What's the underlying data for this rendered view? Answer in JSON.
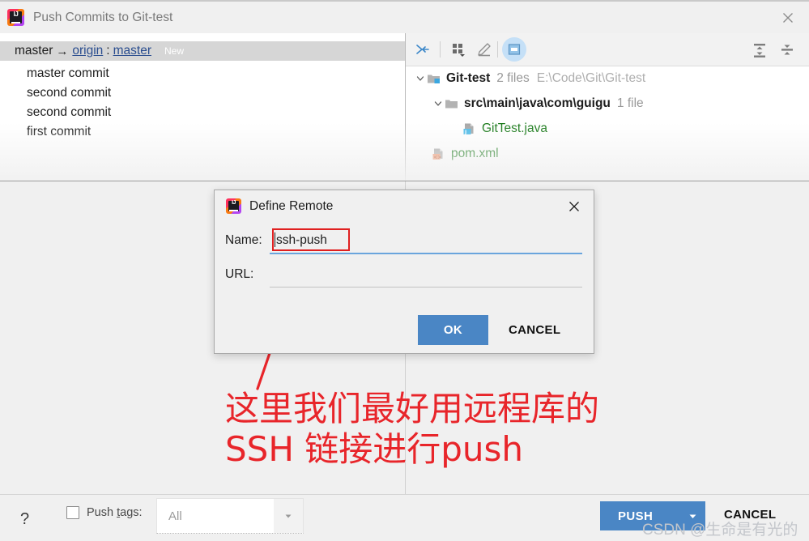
{
  "window": {
    "title": "Push Commits to Git-test",
    "app_icon": "intellij-idea-icon",
    "close_label": "close-icon"
  },
  "left_pane": {
    "branch_row": {
      "local_branch": "master",
      "arrow": "→",
      "remote": "origin",
      "separator": ":",
      "remote_branch": "master",
      "badge": "New"
    },
    "commits": [
      {
        "message": "master commit"
      },
      {
        "message": "second commit"
      },
      {
        "message": "second commit"
      },
      {
        "message": "first commit"
      }
    ]
  },
  "right_pane": {
    "toolbar": {
      "collapse_selection_icon": "arrows-collapse-icon",
      "group_by_icon": "group-by-icon",
      "edit_icon": "edit-source-icon",
      "preview_diff_icon": "preview-diff-icon",
      "expand_all_icon": "expand-all-icon",
      "collapse_all_icon": "collapse-all-icon"
    },
    "tree": [
      {
        "level": 0,
        "chevron": "expanded",
        "icon": "module-folder-icon",
        "name": "Git-test",
        "meta": "2 files",
        "path": "E:\\Code\\Git\\Git-test",
        "style": "module"
      },
      {
        "level": 1,
        "chevron": "expanded",
        "icon": "folder-icon",
        "name": "src\\main\\java\\com\\guigu",
        "meta": "1 file",
        "path": "",
        "style": "folder"
      },
      {
        "level": 2,
        "chevron": "none",
        "icon": "java-file-icon",
        "name": "GitTest.java",
        "meta": "",
        "path": "",
        "style": "file"
      },
      {
        "level": 1,
        "chevron": "none",
        "icon": "xml-file-icon",
        "name": "pom.xml",
        "meta": "",
        "path": "",
        "style": "file"
      }
    ]
  },
  "dialog": {
    "icon": "intellij-idea-icon",
    "title": "Define Remote",
    "close_label": "close-icon",
    "name_label": "Name:",
    "name_value": "ssh-push",
    "url_label": "URL:",
    "url_value": "",
    "ok_label": "OK",
    "cancel_label": "CANCEL"
  },
  "bottom_bar": {
    "help_label": "?",
    "push_tags_label_pre": "Push ",
    "push_tags_label_mnemonic": "t",
    "push_tags_label_post": "ags:",
    "push_tags_checked": false,
    "tags_combo_value": "All",
    "push_label": "PUSH",
    "push_dropdown_icon": "chevron-down-icon",
    "cancel_label": "CANCEL"
  },
  "annotation": {
    "line1": "这里我们最好用远程库的",
    "line2": "SSH 链接进行push",
    "color": "#e8252a",
    "arrow": "red-arrow-annotation"
  },
  "watermark": {
    "text": "CSDN @生命是有光的"
  }
}
